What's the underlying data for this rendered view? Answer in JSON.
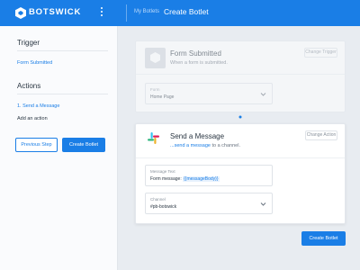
{
  "topbar": {
    "brand": "BOTSWICK",
    "breadcrumb": "My Botlets",
    "title": "Create Botlet",
    "brand_color": "#1a7ee6"
  },
  "sidebar": {
    "trigger_heading": "Trigger",
    "trigger_item": "Form Submitted",
    "actions_heading": "Actions",
    "action_item": "1. Send a Message",
    "add_action": "Add an action",
    "previous_step_label": "Previous Step",
    "create_label": "Create Botlet"
  },
  "trigger_card": {
    "title": "Form Submitted",
    "subtitle": "When a form is submitted.",
    "change_label": "Change Trigger",
    "icon": "hexagon-icon",
    "field": {
      "label": "Form",
      "value": "Home Page"
    }
  },
  "action_card": {
    "title": "Send a Message",
    "subtitle_link": "...send a message",
    "subtitle_rest": " to a channel.",
    "change_label": "Change Action",
    "icon": "slack-icon",
    "message_field": {
      "label": "Message Text",
      "prefix": "Form message: ",
      "token": "{{messageBody}}"
    },
    "channel_field": {
      "label": "Channel",
      "value": "#pb-botswick"
    }
  },
  "footer": {
    "create_label": "Create Botlet"
  }
}
